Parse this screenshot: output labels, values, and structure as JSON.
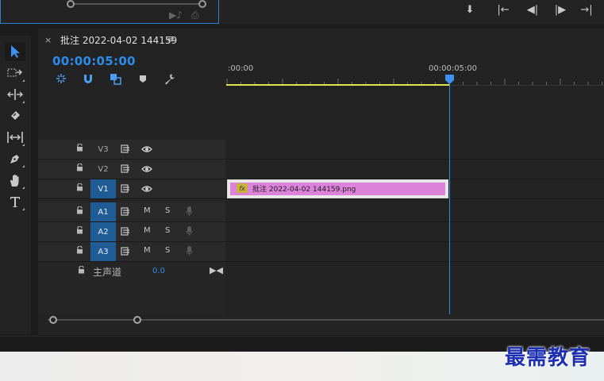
{
  "sequence": {
    "tab_close": "×",
    "tab_title": "批注 2022-04-02 144159",
    "tab_menu": "≡",
    "timecode": "00:00:05:00"
  },
  "ruler": {
    "start_label": ":00:00",
    "mid_label": "00:00:05:00"
  },
  "tracks": {
    "video": [
      {
        "label": "V3",
        "targeted": false
      },
      {
        "label": "V2",
        "targeted": false
      },
      {
        "label": "V1",
        "targeted": true
      }
    ],
    "audio": [
      {
        "label": "A1",
        "targeted": true,
        "mute": "M",
        "solo": "S"
      },
      {
        "label": "A2",
        "targeted": true,
        "mute": "M",
        "solo": "S"
      },
      {
        "label": "A3",
        "targeted": true,
        "mute": "M",
        "solo": "S"
      }
    ],
    "master": {
      "label": "主声道",
      "value": "0.0"
    }
  },
  "clip": {
    "fx_label": "fx",
    "name": "批注 2022-04-02  144159.png",
    "color": "#dd82db"
  },
  "colors": {
    "accent": "#2d8ceb",
    "work_area": "#e2e24a",
    "track_target": "#1f5c96"
  },
  "icons": {
    "tools": [
      "selection-tool-icon",
      "track-select-tool-icon",
      "ripple-edit-tool-icon",
      "razor-tool-icon",
      "slip-tool-icon",
      "pen-tool-icon",
      "hand-tool-icon",
      "type-tool-icon"
    ],
    "header": [
      "nest-icon",
      "snap-magnet-icon",
      "linked-selection-icon",
      "add-marker-icon",
      "wrench-settings-icon"
    ]
  },
  "watermark": "最需教育"
}
